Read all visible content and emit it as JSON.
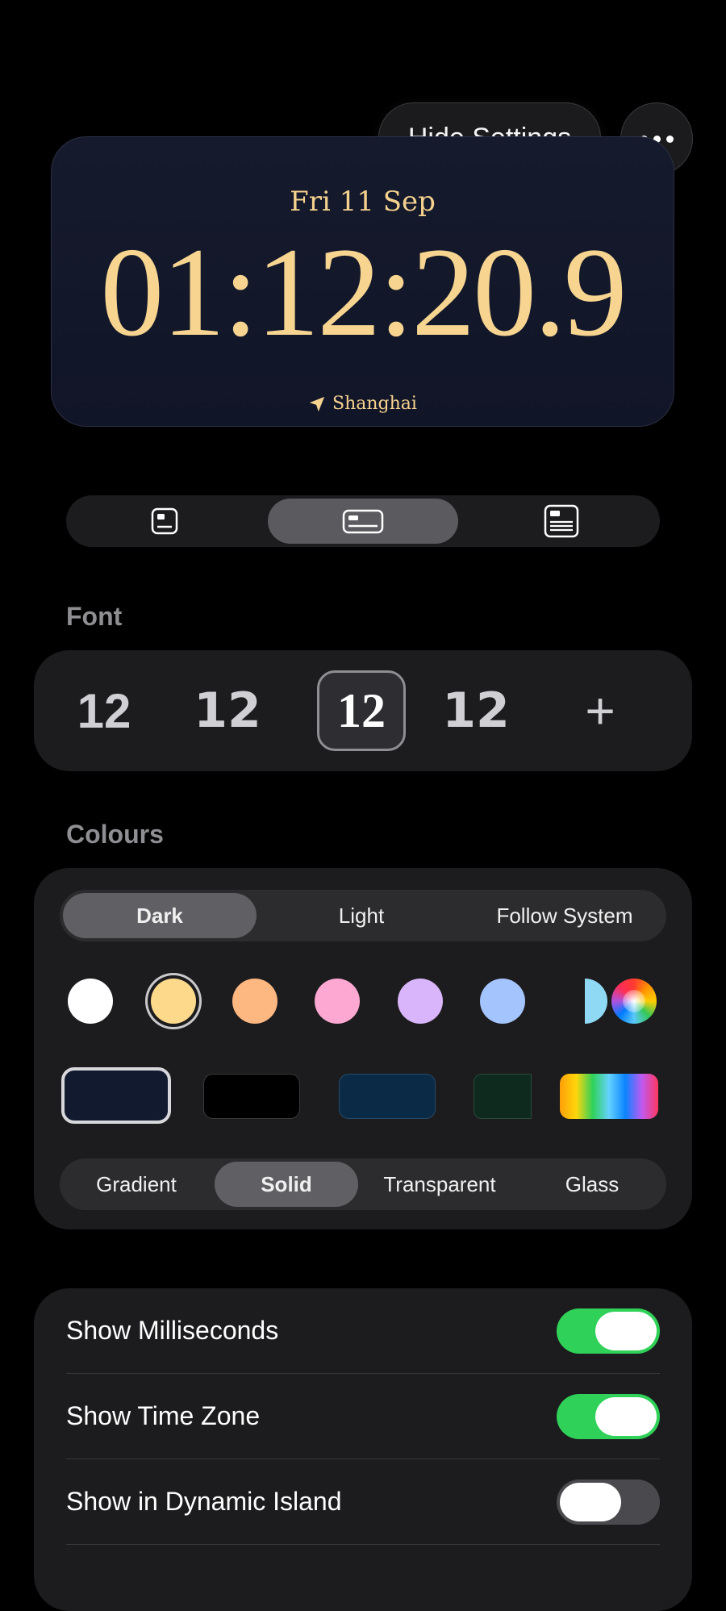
{
  "header": {
    "hide_settings_label": "Hide Settings",
    "more_icon": "ellipsis-icon"
  },
  "clock": {
    "date": "Fri 11 Sep",
    "time": "01:12:20.9",
    "location": "Shanghai",
    "location_icon": "location-arrow-icon",
    "text_color": "#f7d591",
    "background_color": "#131829"
  },
  "layout_options": [
    {
      "icon": "small-widget-icon",
      "selected": false
    },
    {
      "icon": "wide-widget-icon",
      "selected": true
    },
    {
      "icon": "large-widget-icon",
      "selected": false
    }
  ],
  "font_section": {
    "label": "Font",
    "options": [
      "12",
      "12",
      "12",
      "12"
    ],
    "selected_index": 2,
    "add_label": "+"
  },
  "colours_section": {
    "label": "Colours",
    "modes": [
      "Dark",
      "Light",
      "Follow System"
    ],
    "selected_mode": "Dark",
    "text_colors": [
      "#ffffff",
      "#fdd98c",
      "#fdb780",
      "#fca8d2",
      "#d9b6fb",
      "#a4c4fd",
      "#8fd9f5",
      "rainbow"
    ],
    "selected_text_color": "#fdd98c",
    "backgrounds": [
      "#121a30",
      "#000000",
      "#0b2a45",
      "#0e2a1e",
      "rainbow"
    ],
    "selected_background": "#121a30",
    "styles": [
      "Gradient",
      "Solid",
      "Transparent",
      "Glass"
    ],
    "selected_style": "Solid"
  },
  "toggles": [
    {
      "label": "Show Milliseconds",
      "on": true
    },
    {
      "label": "Show Time Zone",
      "on": true
    },
    {
      "label": "Show in Dynamic Island",
      "on": false
    }
  ],
  "colors": {
    "accent_green": "#30d158",
    "panel": "#1c1c1e"
  }
}
